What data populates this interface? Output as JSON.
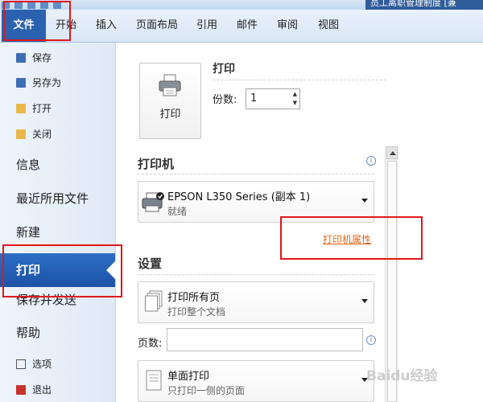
{
  "titlebar": {
    "title": "员工离职管理制度 [兼"
  },
  "tabs": [
    "文件",
    "开始",
    "插入",
    "页面布局",
    "引用",
    "邮件",
    "审阅",
    "视图"
  ],
  "left": {
    "save": "保存",
    "save_as": "另存为",
    "open": "打开",
    "close": "关闭",
    "info": "信息",
    "recent": "最近所用文件",
    "new": "新建",
    "print": "打印",
    "save_send": "保存并发送",
    "help": "帮助",
    "options": "选项",
    "exit": "退出"
  },
  "print": {
    "button_label": "打印",
    "heading": "打印",
    "copies_label": "份数:",
    "copies_value": "1"
  },
  "printer": {
    "section": "打印机",
    "name": "EPSON L350 Series (副本 1)",
    "status": "就绪",
    "properties_link": "打印机属性"
  },
  "settings": {
    "section": "设置",
    "range_title": "打印所有页",
    "range_sub": "打印整个文档",
    "pages_label": "页数:",
    "sides_title": "单面打印",
    "sides_sub": "只打印一侧的页面"
  },
  "watermark": "Baidu经验",
  "colors": {
    "file_tab": "#2a62b0",
    "highlight": "#e0181b",
    "link": "#e0661b"
  }
}
